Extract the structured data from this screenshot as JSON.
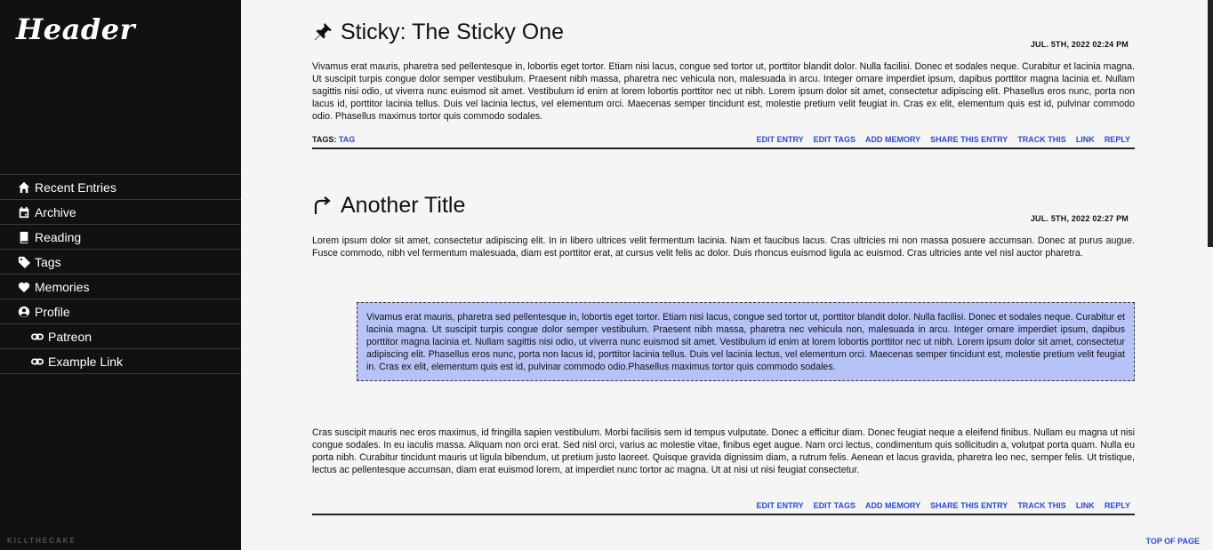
{
  "site": {
    "title": "Header",
    "credit": "KILLTHECAKE"
  },
  "nav": {
    "items": [
      {
        "label": "Recent Entries",
        "icon": "home-icon"
      },
      {
        "label": "Archive",
        "icon": "calendar-icon"
      },
      {
        "label": "Reading",
        "icon": "book-icon"
      },
      {
        "label": "Tags",
        "icon": "tag-icon"
      },
      {
        "label": "Memories",
        "icon": "heart-icon"
      },
      {
        "label": "Profile",
        "icon": "user-circle-icon"
      },
      {
        "label": "Patreon",
        "icon": "link-icon"
      },
      {
        "label": "Example Link",
        "icon": "link-icon"
      }
    ]
  },
  "entries": [
    {
      "icon": "pushpin-icon",
      "title": "Sticky: The Sticky One",
      "date": "JUL. 5TH, 2022 02:24 PM",
      "body": "Vivamus erat mauris, pharetra sed pellentesque in, lobortis eget tortor. Etiam nisi lacus, congue sed tortor ut, porttitor blandit dolor. Nulla facilisi. Donec et sodales neque. Curabitur et lacinia magna. Ut suscipit turpis congue dolor semper vestibulum. Praesent nibh massa, pharetra nec vehicula non, malesuada in arcu. Integer ornare imperdiet ipsum, dapibus porttitor magna lacinia et. Nullam sagittis nisi odio, ut viverra nunc euismod sit amet. Vestibulum id enim at lorem lobortis porttitor nec ut nibh. Lorem ipsum dolor sit amet, consectetur adipiscing elit. Phasellus eros nunc, porta non lacus id, porttitor lacinia tellus. Duis vel lacinia lectus, vel elementum orci. Maecenas semper tincidunt est, molestie pretium velit feugiat in. Cras ex elit, elementum quis est id, pulvinar commodo odio. Phasellus maximus tortor quis commodo sodales.",
      "tags_label": "TAGS:",
      "tag": "TAG"
    },
    {
      "icon": "share-arrow-icon",
      "title": "Another Title",
      "date": "JUL. 5TH, 2022 02:27 PM",
      "body": "Lorem ipsum dolor sit amet, consectetur adipiscing elit. In in libero ultrices velit fermentum lacinia. Nam et faucibus lacus. Cras ultricies mi non massa posuere accumsan. Donec at purus augue. Fusce commodo, nibh vel fermentum malesuada, diam est porttitor erat, at cursus velit felis ac dolor. Duis rhoncus euismod ligula ac euismod. Cras ultricies ante vel nisl auctor pharetra.",
      "quote": "Vivamus erat mauris, pharetra sed pellentesque in, lobortis eget tortor. Etiam nisi lacus, congue sed tortor ut, porttitor blandit dolor. Nulla facilisi. Donec et sodales neque. Curabitur et lacinia magna. Ut suscipit turpis congue dolor semper vestibulum. Praesent nibh massa, pharetra nec vehicula non, malesuada in arcu. Integer ornare imperdiet ipsum, dapibus porttitor magna lacinia et. Nullam sagittis nisi odio, ut viverra nunc euismod sit amet. Vestibulum id enim at lorem lobortis porttitor nec ut nibh. Lorem ipsum dolor sit amet, consectetur adipiscing elit. Phasellus eros nunc, porta non lacus id, porttitor lacinia tellus. Duis vel lacinia lectus, vel elementum orci. Maecenas semper tincidunt est, molestie pretium velit feugiat in. Cras ex elit, elementum quis est id, pulvinar commodo odio.Phasellus maximus tortor quis commodo sodales.",
      "body2": "Cras suscipit mauris nec eros maximus, id fringilla sapien vestibulum. Morbi facilisis sem id tempus vulputate. Donec a efficitur diam. Donec feugiat neque a eleifend finibus. Nullam eu magna ut nisi congue sodales. In eu iaculis massa. Aliquam non orci erat. Sed nisl orci, varius ac molestie vitae, finibus eget augue. Nam orci lectus, condimentum quis sollicitudin a, volutpat porta quam. Nulla eu porta nibh. Curabitur tincidunt mauris ut ligula bibendum, ut pretium justo laoreet. Quisque gravida dignissim diam, a rutrum felis. Aenean et lacus gravida, pharetra leo nec, semper felis. Ut tristique, lectus ac pellentesque accumsan, diam erat euismod lorem, at imperdiet nunc tortor ac magna. Ut at nisi ut nisi feugiat consectetur."
    }
  ],
  "actions": {
    "edit_entry": "EDIT ENTRY",
    "edit_tags": "EDIT TAGS",
    "add_memory": "ADD MEMORY",
    "share": "SHARE THIS ENTRY",
    "track": "TRACK THIS",
    "link": "LINK",
    "reply": "REPLY"
  },
  "top_of_page": "TOP OF PAGE",
  "colors": {
    "sidebar_bg": "#111111",
    "page_bg": "#f5f5f5",
    "link": "#2a4bd8",
    "quote_bg": "#b7c3f7"
  }
}
